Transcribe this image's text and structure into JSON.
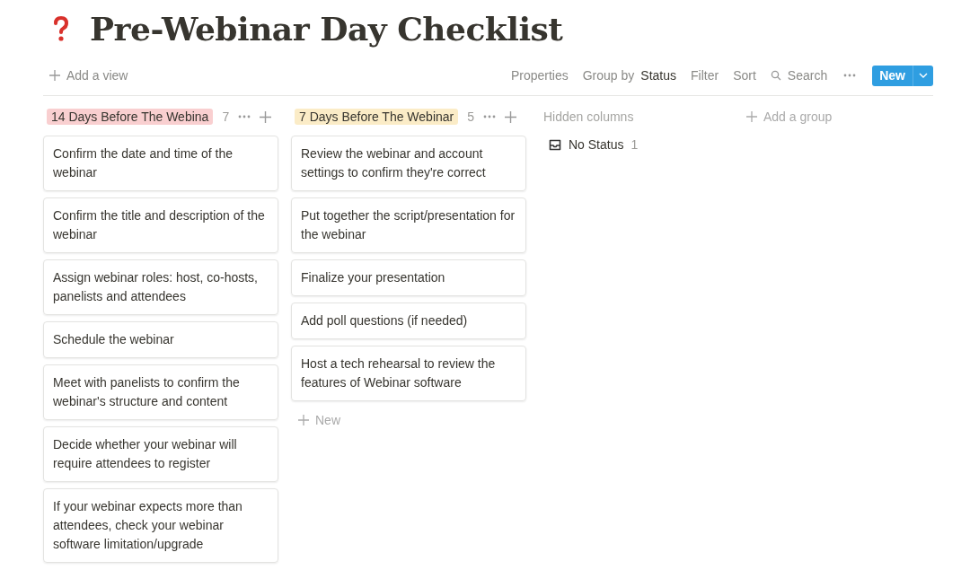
{
  "page": {
    "title": "Pre-Webinar Day Checklist"
  },
  "view_bar": {
    "add_view": "Add a view",
    "tools": [
      {
        "kind": "text",
        "label": "Properties"
      },
      {
        "kind": "group",
        "label": "Group by",
        "value": "Status"
      },
      {
        "kind": "text",
        "label": "Filter"
      },
      {
        "kind": "text",
        "label": "Sort"
      },
      {
        "kind": "search",
        "label": "Search"
      },
      {
        "kind": "more"
      }
    ],
    "new_button": "New"
  },
  "columns": [
    {
      "title": "14 Days Before The Webina",
      "color": "#f9cfd0",
      "count": "7",
      "cards": [
        "Confirm the date and time of the webinar",
        "Confirm the title and description of the webinar",
        "Assign webinar roles: host, co-hosts, panelists and attendees",
        "Schedule the webinar",
        "Meet with panelists to confirm the webinar's structure and content",
        "Decide whether your webinar will require attendees to register",
        "If your webinar expects more than attendees, check your webinar software limitation/upgrade"
      ]
    },
    {
      "title": "7 Days Before The Webinar",
      "color": "#fbecc7",
      "count": "5",
      "cards": [
        "Review the webinar and account settings to confirm they're correct",
        "Put together the script/presentation for the webinar",
        "Finalize your presentation",
        "Add poll questions (if needed)",
        "Host a tech rehearsal to review the features of Webinar software"
      ],
      "new_label": "New"
    }
  ],
  "hidden": {
    "heading": "Hidden columns",
    "items": [
      {
        "label": "No Status",
        "count": "1"
      }
    ]
  },
  "add_group": "Add a group"
}
